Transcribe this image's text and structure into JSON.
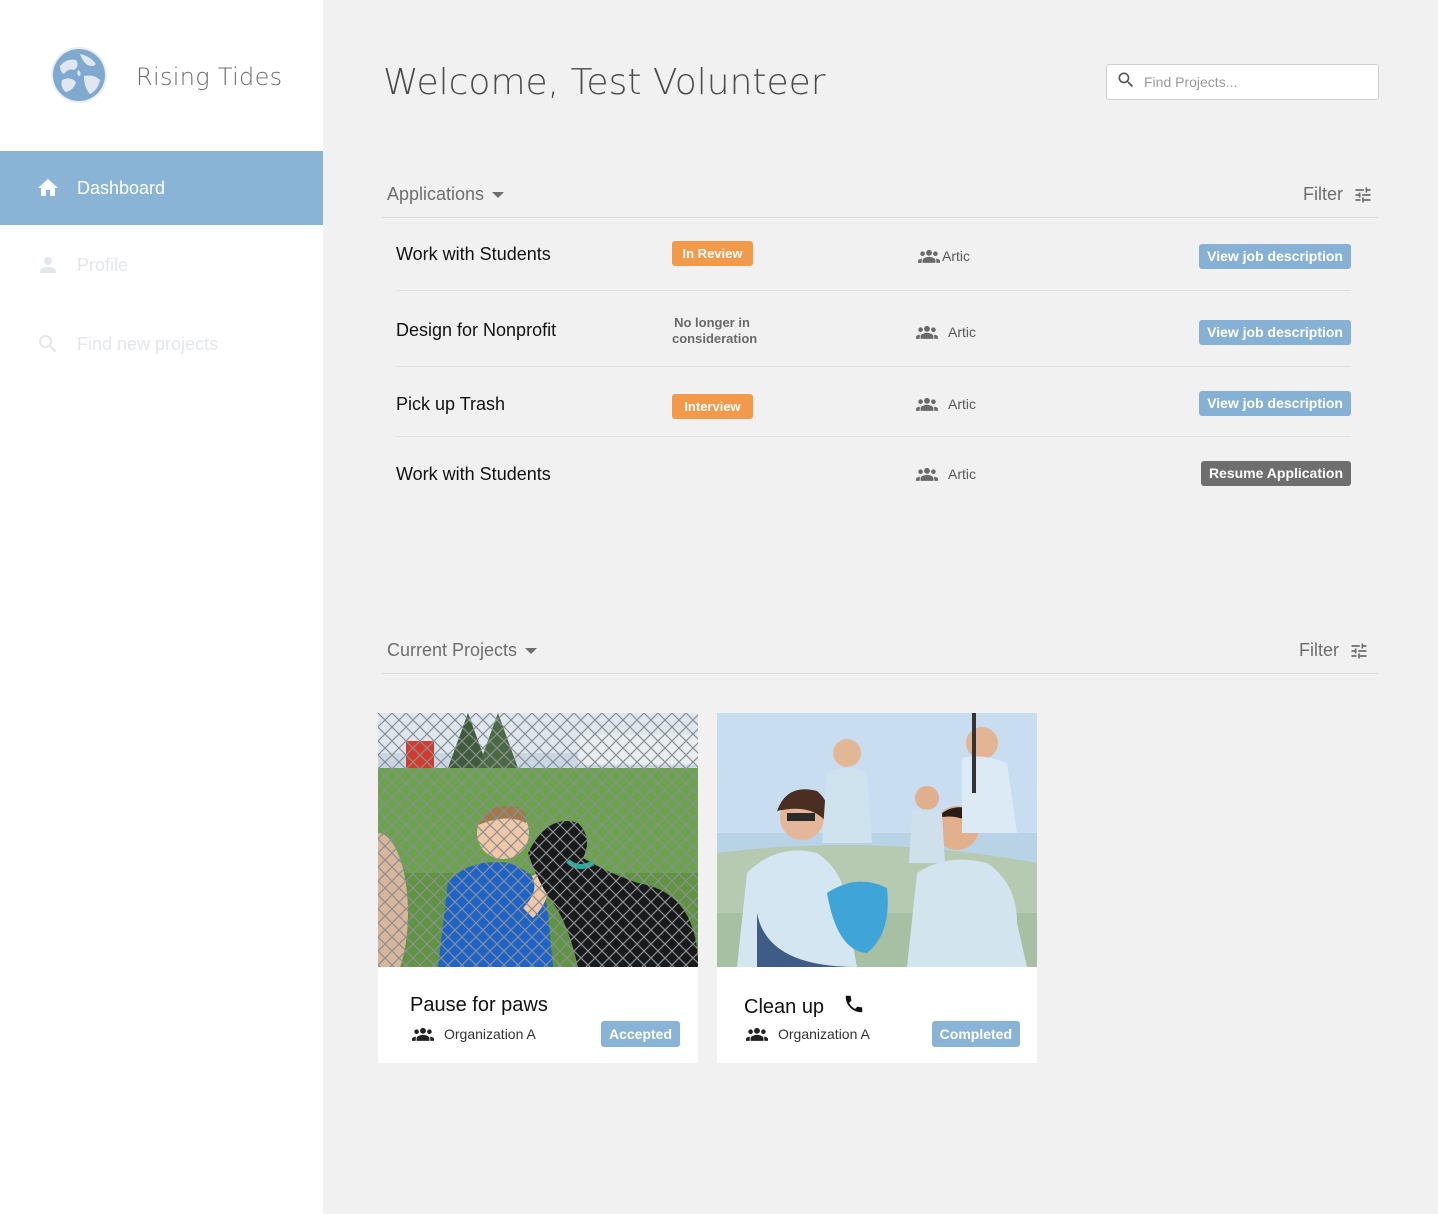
{
  "app": {
    "name": "Rising Tides"
  },
  "sidebar": {
    "items": [
      {
        "label": "Dashboard",
        "icon": "home-icon",
        "active": true
      },
      {
        "label": "Profile",
        "icon": "person-icon",
        "active": false
      },
      {
        "label": "Find new projects",
        "icon": "search-icon",
        "active": false
      }
    ]
  },
  "header": {
    "welcome": "Welcome, Test Volunteer",
    "search_placeholder": "Find Projects..."
  },
  "applications": {
    "title": "Applications",
    "filter_label": "Filter",
    "rows": [
      {
        "title": "Work with Students",
        "status": "In Review",
        "org": "Artic",
        "action": "View job description"
      },
      {
        "title": "Design for Nonprofit",
        "status_line1": "No longer in",
        "status_line2": "consideration",
        "org": "Artic",
        "action": "View job description"
      },
      {
        "title": "Pick up Trash",
        "status": "Interview",
        "org": "Artic",
        "action": "View job description"
      },
      {
        "title": "Work with Students",
        "status": "",
        "org": "Artic",
        "action": "Resume Application"
      }
    ]
  },
  "projects": {
    "title": "Current Projects",
    "filter_label": "Filter",
    "cards": [
      {
        "title": "Pause for paws",
        "org": "Organization A",
        "badge": "Accepted"
      },
      {
        "title": "Clean up",
        "org": "Organization A",
        "badge": "Completed",
        "icon": "phone-icon"
      }
    ]
  },
  "colors": {
    "accent_blue": "#8ab4d6",
    "status_orange": "#f2994a",
    "dark_button": "#6e6e6e",
    "background": "#f1f1f1"
  }
}
